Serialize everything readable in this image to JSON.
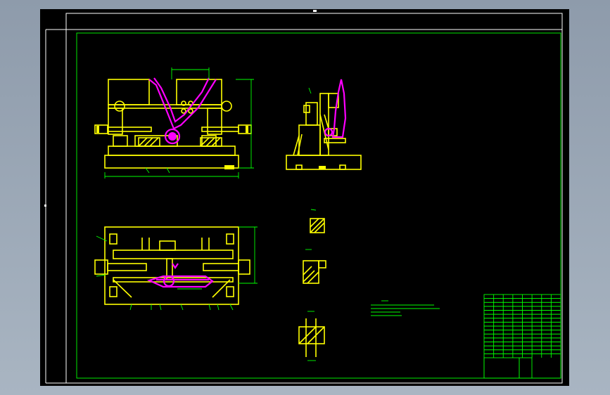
{
  "app": {
    "background_color": "#000000"
  },
  "colors": {
    "part_outline": "#ffff00",
    "workpiece": "#ff00ff",
    "dimension": "#00ff00",
    "frame": "#ffffff"
  },
  "drawing": {
    "title_block_rows": 16,
    "title_block_cols": 8
  }
}
